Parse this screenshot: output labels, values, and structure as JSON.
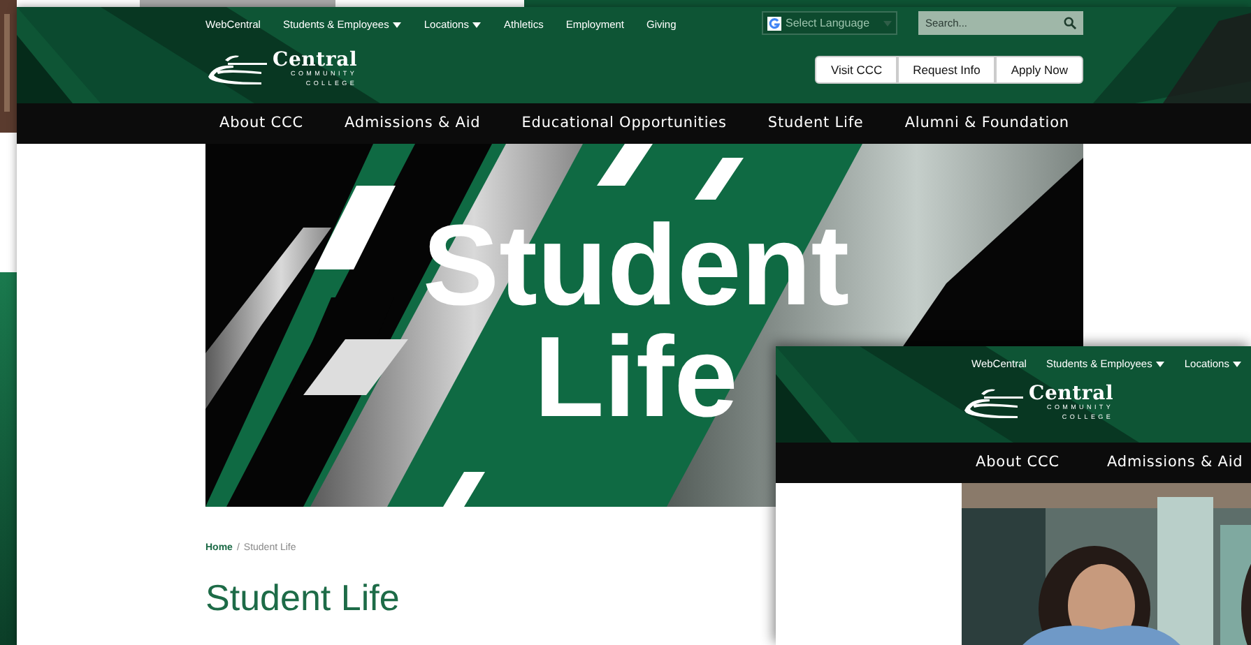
{
  "pages": [
    {
      "kind": "desktop",
      "top_links": [
        {
          "label": "WebCentral",
          "has_menu": false
        },
        {
          "label": "Students & Employees",
          "has_menu": true
        },
        {
          "label": "Locations",
          "has_menu": true
        },
        {
          "label": "Athletics",
          "has_menu": false
        },
        {
          "label": "Employment",
          "has_menu": false
        },
        {
          "label": "Giving",
          "has_menu": false
        }
      ],
      "language_select": {
        "label": "Select Language"
      },
      "search": {
        "placeholder": "Search..."
      },
      "action_buttons": [
        "Visit CCC",
        "Request Info",
        "Apply Now"
      ],
      "logo": {
        "name": "Central",
        "line_2": "COMMUNITY",
        "line_3": "COLLEGE"
      },
      "main_nav": [
        "About CCC",
        "Admissions & Aid",
        "Educational Opportunities",
        "Student Life",
        "Alumni & Foundation"
      ],
      "hero": {
        "title": "Student Life"
      },
      "breadcrumb": {
        "separator": "/",
        "items": [
          {
            "label": "Home",
            "current": false
          },
          {
            "label": "Student Life",
            "current": true
          }
        ]
      },
      "heading": "Student Life"
    },
    {
      "kind": "tablet",
      "top_links": [
        {
          "label": "WebCentral",
          "has_menu": false
        },
        {
          "label": "Students & Employees",
          "has_menu": true
        },
        {
          "label": "Locations",
          "has_menu": true
        }
      ],
      "logo": {
        "name": "Central",
        "line_2": "COMMUNITY",
        "line_3": "COLLEGE"
      },
      "main_nav": [
        "About CCC",
        "Admissions & Aid"
      ],
      "photo": {
        "kind": "picture"
      }
    }
  ]
}
